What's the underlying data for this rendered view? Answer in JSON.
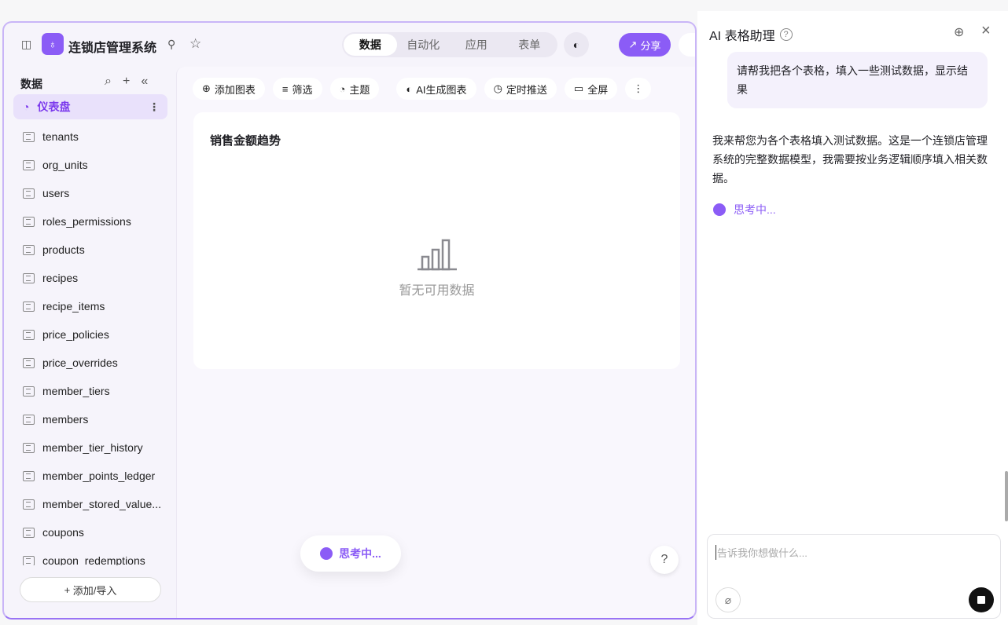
{
  "header": {
    "app_title": "连锁店管理系统",
    "tabs": [
      "数据",
      "自动化",
      "应用",
      "表单"
    ],
    "active_tab": "数据",
    "share_label": "分享"
  },
  "sidebar": {
    "heading": "数据",
    "items": [
      {
        "label": "仪表盘",
        "active": true
      },
      {
        "label": "tenants"
      },
      {
        "label": "org_units"
      },
      {
        "label": "users"
      },
      {
        "label": "roles_permissions"
      },
      {
        "label": "products"
      },
      {
        "label": "recipes"
      },
      {
        "label": "recipe_items"
      },
      {
        "label": "price_policies"
      },
      {
        "label": "price_overrides"
      },
      {
        "label": "member_tiers"
      },
      {
        "label": "members"
      },
      {
        "label": "member_tier_history"
      },
      {
        "label": "member_points_ledger"
      },
      {
        "label": "member_stored_value..."
      },
      {
        "label": "coupons"
      },
      {
        "label": "coupon_redemptions"
      }
    ],
    "add_label": "添加/导入"
  },
  "toolbar": {
    "add_chart": "添加图表",
    "filter": "筛选",
    "theme": "主题",
    "ai_chart": "AI生成图表",
    "schedule": "定时推送",
    "fullscreen": "全屏"
  },
  "card": {
    "title": "销售金额趋势",
    "empty": "暂无可用数据"
  },
  "thinking": "思考中...",
  "help": "?",
  "assistant": {
    "title": "AI 表格助理",
    "user_message": "请帮我把各个表格，填入一些测试数据，显示结果",
    "ai_message": "我来帮您为各个表格填入测试数据。这是一个连锁店管理系统的完整数据模型，我需要按业务逻辑顺序填入相关数据。",
    "thinking": "思考中...",
    "input_placeholder": "告诉我你想做什么..."
  },
  "colors": {
    "accent": "#8b5cf6"
  }
}
